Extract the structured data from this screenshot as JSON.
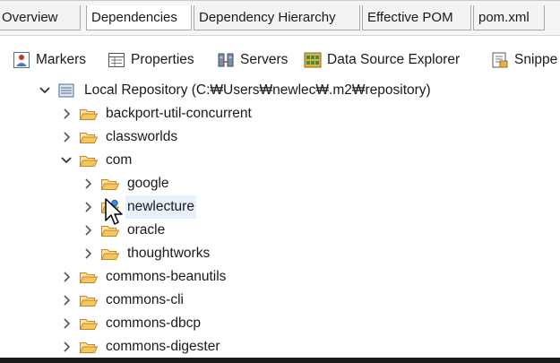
{
  "editor_tabs": [
    {
      "label": "Overview",
      "active": false
    },
    {
      "label": "Dependencies",
      "active": true
    },
    {
      "label": "Dependency Hierarchy",
      "active": false
    },
    {
      "label": "Effective POM",
      "active": false
    },
    {
      "label": "pom.xml",
      "active": false
    }
  ],
  "views": [
    {
      "label": "Markers",
      "icon": "markers-icon"
    },
    {
      "label": "Properties",
      "icon": "properties-icon"
    },
    {
      "label": "Servers",
      "icon": "servers-icon"
    },
    {
      "label": "Data Source Explorer",
      "icon": "data-source-explorer-icon"
    },
    {
      "label": "Snippe",
      "icon": "snippets-icon"
    }
  ],
  "tree": {
    "root": {
      "label": "Local Repository (C:₩Users₩newlec₩.m2₩repository)",
      "expanded": true,
      "icon": "repository-icon"
    },
    "items": [
      {
        "label": "backport-util-concurrent",
        "level": 1,
        "expanded": false
      },
      {
        "label": "classworlds",
        "level": 1,
        "expanded": false
      },
      {
        "label": "com",
        "level": 1,
        "expanded": true
      },
      {
        "label": "google",
        "level": 2,
        "expanded": false
      },
      {
        "label": "newlecture",
        "level": 2,
        "expanded": false,
        "selected": true
      },
      {
        "label": "oracle",
        "level": 2,
        "expanded": false
      },
      {
        "label": "thoughtworks",
        "level": 2,
        "expanded": false
      },
      {
        "label": "commons-beanutils",
        "level": 1,
        "expanded": false
      },
      {
        "label": "commons-cli",
        "level": 1,
        "expanded": false
      },
      {
        "label": "commons-dbcp",
        "level": 1,
        "expanded": false
      },
      {
        "label": "commons-digester",
        "level": 1,
        "expanded": false
      }
    ]
  },
  "colors": {
    "folder": "#e8b04a",
    "selection": "#e8f1fb",
    "tab_border": "#a9a9a9"
  }
}
